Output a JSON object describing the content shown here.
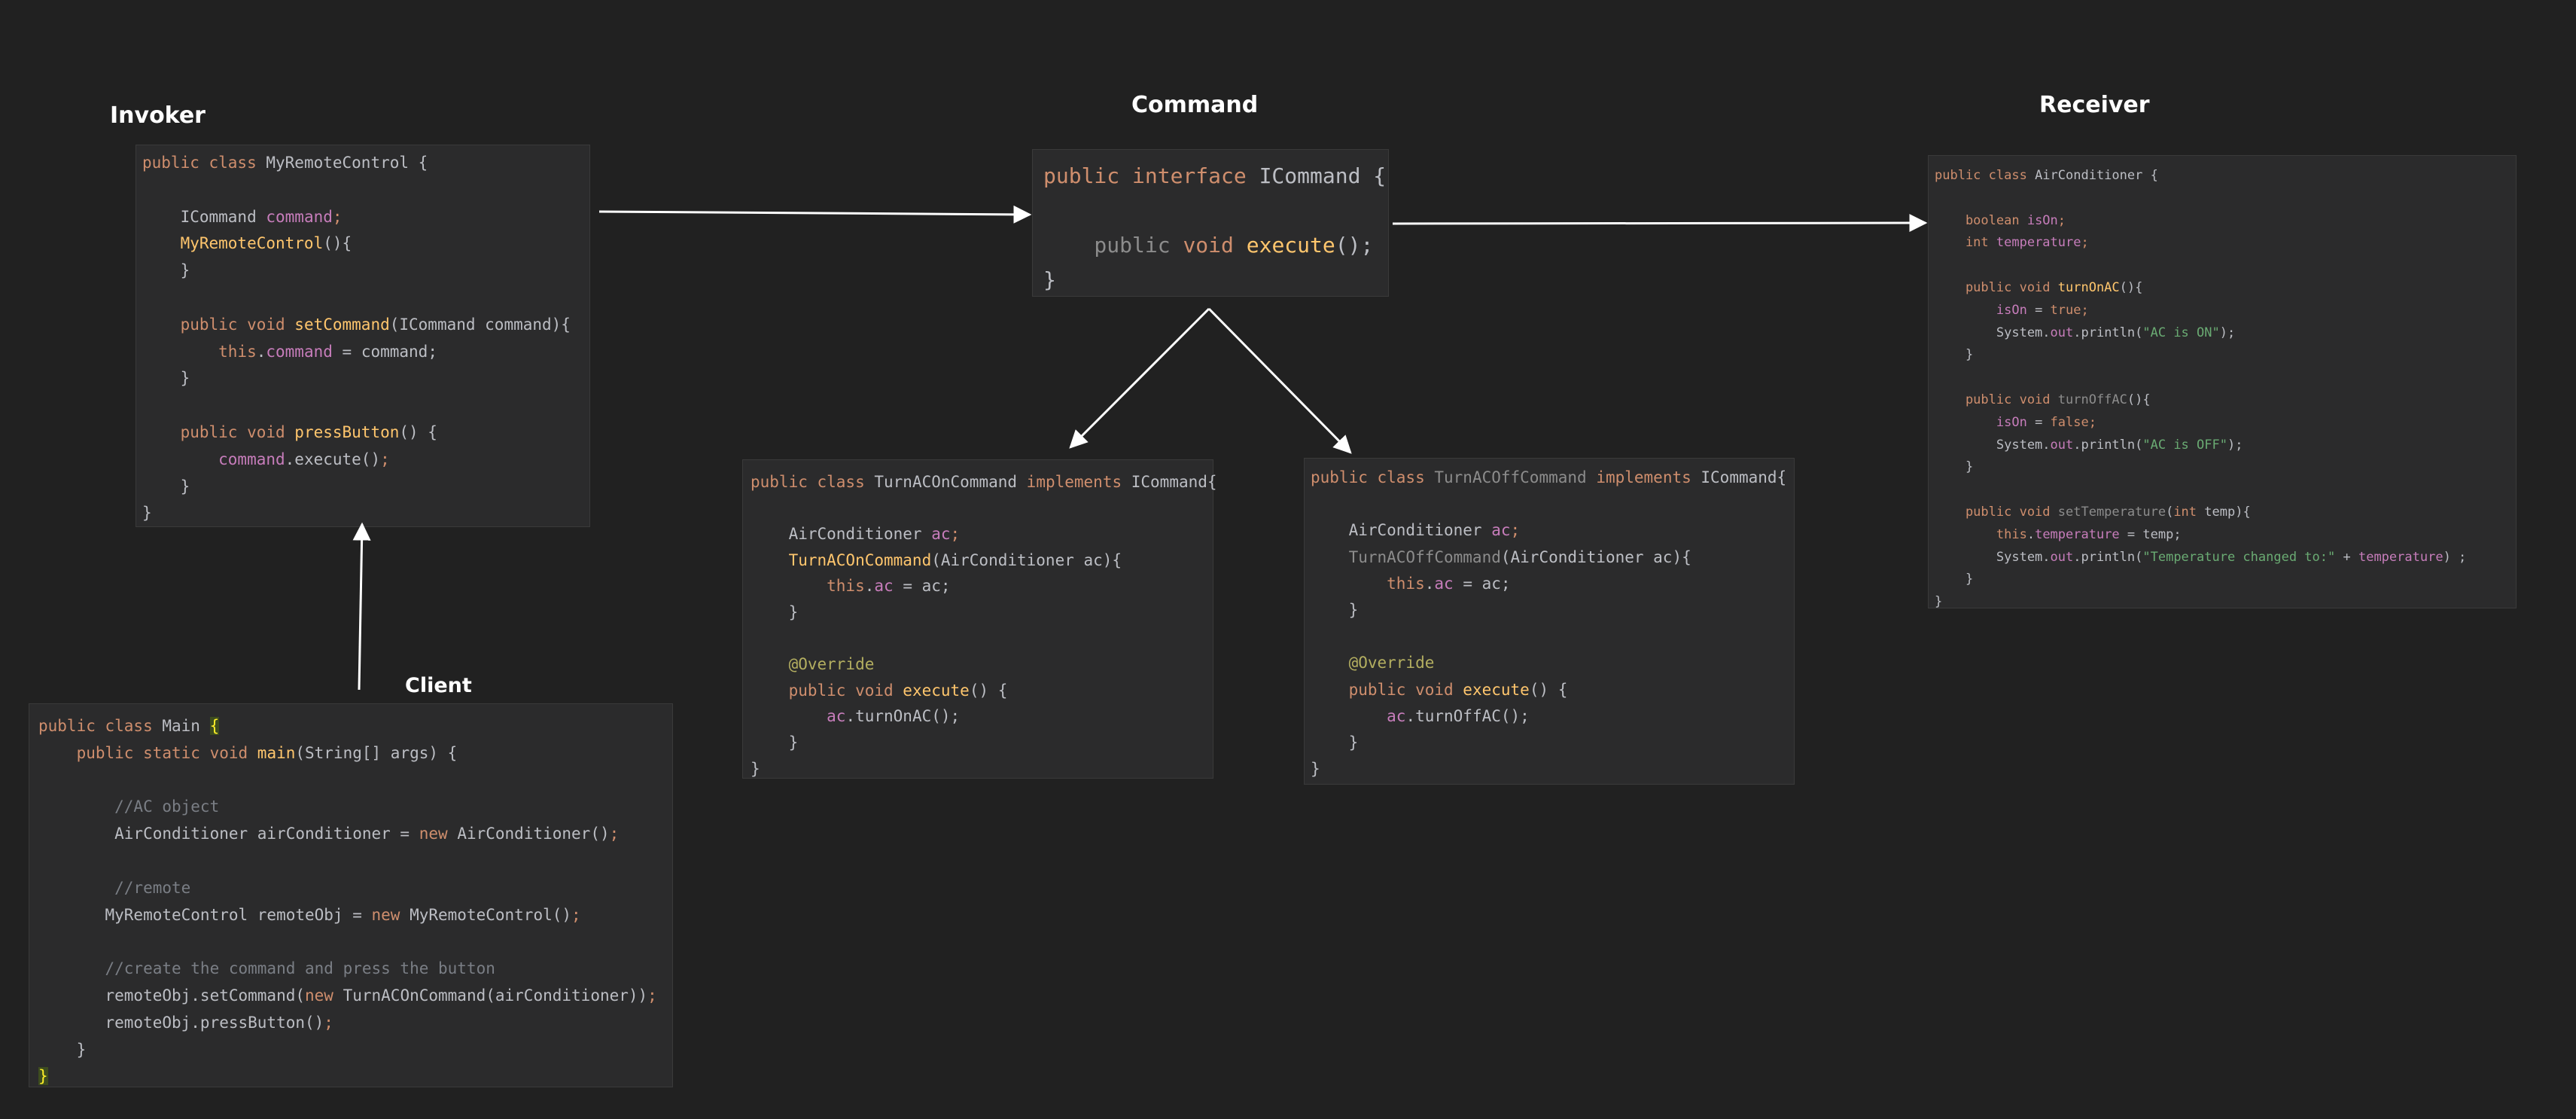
{
  "titles": {
    "invoker": "Invoker",
    "command": "Command",
    "receiver": "Receiver",
    "client": "Client"
  },
  "invoker_code": [
    [
      [
        "k",
        "public class "
      ],
      [
        "p",
        "MyRemoteControl {"
      ]
    ],
    [],
    [
      [
        "p",
        "    ICommand "
      ],
      [
        "v",
        "command"
      ],
      [
        "k",
        ";"
      ]
    ],
    [
      [
        "f",
        "    MyRemoteControl"
      ],
      [
        "p",
        "(){"
      ]
    ],
    [
      [
        "p",
        "    }"
      ]
    ],
    [],
    [
      [
        "k",
        "    public void "
      ],
      [
        "f",
        "setCommand"
      ],
      [
        "p",
        "(ICommand command){"
      ]
    ],
    [
      [
        "k",
        "        this"
      ],
      [
        "p",
        "."
      ],
      [
        "v",
        "command"
      ],
      [
        "p",
        " = command;"
      ]
    ],
    [
      [
        "p",
        "    }"
      ]
    ],
    [],
    [
      [
        "k",
        "    public void "
      ],
      [
        "f",
        "pressButton"
      ],
      [
        "p",
        "() {"
      ]
    ],
    [
      [
        "v",
        "        command"
      ],
      [
        "p",
        ".execute()"
      ],
      [
        "k",
        ";"
      ]
    ],
    [
      [
        "p",
        "    }"
      ]
    ],
    [
      [
        "p",
        "}"
      ]
    ]
  ],
  "command_code": [
    [
      [
        "k",
        "public interface "
      ],
      [
        "p",
        "ICommand {"
      ]
    ],
    [],
    [
      [
        "g",
        "    public "
      ],
      [
        "k",
        "void "
      ],
      [
        "f",
        "execute"
      ],
      [
        "p",
        "();"
      ]
    ],
    [
      [
        "p",
        "}"
      ]
    ]
  ],
  "receiver_code": [
    [
      [
        "k",
        "public class "
      ],
      [
        "p",
        "AirConditioner {"
      ]
    ],
    [],
    [
      [
        "k",
        "    boolean "
      ],
      [
        "v",
        "isOn"
      ],
      [
        "k",
        ";"
      ]
    ],
    [
      [
        "k",
        "    int "
      ],
      [
        "v",
        "temperature"
      ],
      [
        "k",
        ";"
      ]
    ],
    [],
    [
      [
        "k",
        "    public void "
      ],
      [
        "f",
        "turnOnAC"
      ],
      [
        "p",
        "(){"
      ]
    ],
    [
      [
        "v",
        "        isOn"
      ],
      [
        "p",
        " = "
      ],
      [
        "k",
        "true;"
      ]
    ],
    [
      [
        "p",
        "        System."
      ],
      [
        "v",
        "out"
      ],
      [
        "p",
        ".println("
      ],
      [
        "s",
        "\"AC is ON\""
      ],
      [
        "p",
        ");"
      ]
    ],
    [
      [
        "p",
        "    }"
      ]
    ],
    [],
    [
      [
        "k",
        "    public void "
      ],
      [
        "g",
        "turnOffAC"
      ],
      [
        "p",
        "(){"
      ]
    ],
    [
      [
        "v",
        "        isOn"
      ],
      [
        "p",
        " = "
      ],
      [
        "k",
        "false;"
      ]
    ],
    [
      [
        "p",
        "        System."
      ],
      [
        "v",
        "out"
      ],
      [
        "p",
        ".println("
      ],
      [
        "s",
        "\"AC is OFF\""
      ],
      [
        "p",
        ");"
      ]
    ],
    [
      [
        "p",
        "    }"
      ]
    ],
    [],
    [
      [
        "k",
        "    public void "
      ],
      [
        "g",
        "setTemperature"
      ],
      [
        "p",
        "("
      ],
      [
        "k",
        "int "
      ],
      [
        "p",
        "temp){"
      ]
    ],
    [
      [
        "k",
        "        this"
      ],
      [
        "p",
        "."
      ],
      [
        "v",
        "temperature"
      ],
      [
        "p",
        " = temp;"
      ]
    ],
    [
      [
        "p",
        "        System."
      ],
      [
        "v",
        "out"
      ],
      [
        "p",
        ".println("
      ],
      [
        "s",
        "\"Temperature changed to:\""
      ],
      [
        "p",
        " + "
      ],
      [
        "v",
        "temperature"
      ],
      [
        "p",
        ") ;"
      ]
    ],
    [
      [
        "p",
        "    }"
      ]
    ],
    [
      [
        "p",
        "}"
      ]
    ]
  ],
  "on_code": [
    [
      [
        "k",
        "public class "
      ],
      [
        "p",
        "TurnACOnCommand "
      ],
      [
        "k",
        "implements "
      ],
      [
        "p",
        "ICommand{"
      ]
    ],
    [],
    [
      [
        "p",
        "    AirConditioner "
      ],
      [
        "v",
        "ac"
      ],
      [
        "k",
        ";"
      ]
    ],
    [
      [
        "f",
        "    TurnACOnCommand"
      ],
      [
        "p",
        "(AirConditioner ac){"
      ]
    ],
    [
      [
        "k",
        "        this"
      ],
      [
        "p",
        "."
      ],
      [
        "v",
        "ac"
      ],
      [
        "p",
        " = ac;"
      ]
    ],
    [
      [
        "p",
        "    }"
      ]
    ],
    [],
    [
      [
        "a",
        "    @Override"
      ]
    ],
    [
      [
        "k",
        "    public void "
      ],
      [
        "f",
        "execute"
      ],
      [
        "p",
        "() {"
      ]
    ],
    [
      [
        "v",
        "        ac"
      ],
      [
        "p",
        ".turnOnAC();"
      ]
    ],
    [
      [
        "p",
        "    }"
      ]
    ],
    [
      [
        "p",
        "}"
      ]
    ]
  ],
  "off_code": [
    [
      [
        "k",
        "public class "
      ],
      [
        "g",
        "TurnACOffCommand "
      ],
      [
        "k",
        "implements "
      ],
      [
        "p",
        "ICommand{"
      ]
    ],
    [],
    [
      [
        "p",
        "    AirConditioner "
      ],
      [
        "v",
        "ac"
      ],
      [
        "k",
        ";"
      ]
    ],
    [
      [
        "g",
        "    TurnACOffCommand"
      ],
      [
        "p",
        "(AirConditioner ac){"
      ]
    ],
    [
      [
        "k",
        "        this"
      ],
      [
        "p",
        "."
      ],
      [
        "v",
        "ac"
      ],
      [
        "p",
        " = ac;"
      ]
    ],
    [
      [
        "p",
        "    }"
      ]
    ],
    [],
    [
      [
        "a",
        "    @Override"
      ]
    ],
    [
      [
        "k",
        "    public void "
      ],
      [
        "f",
        "execute"
      ],
      [
        "p",
        "() {"
      ]
    ],
    [
      [
        "v",
        "        ac"
      ],
      [
        "p",
        ".turnOffAC();"
      ]
    ],
    [
      [
        "p",
        "    }"
      ]
    ],
    [
      [
        "p",
        "}"
      ]
    ]
  ],
  "client_code": [
    [
      [
        "k",
        "public class "
      ],
      [
        "p",
        "Main "
      ],
      [
        "h",
        "{"
      ]
    ],
    [
      [
        "k",
        "    public static void "
      ],
      [
        "f",
        "main"
      ],
      [
        "p",
        "(String[] args) {"
      ]
    ],
    [],
    [
      [
        "c",
        "        //AC object"
      ]
    ],
    [
      [
        "p",
        "        AirConditioner airConditioner = "
      ],
      [
        "k",
        "new "
      ],
      [
        "p",
        "AirConditioner()"
      ],
      [
        "k",
        ";"
      ]
    ],
    [],
    [
      [
        "c",
        "        //remote"
      ]
    ],
    [
      [
        "p",
        "       MyRemoteControl remoteObj = "
      ],
      [
        "k",
        "new "
      ],
      [
        "p",
        "MyRemoteControl()"
      ],
      [
        "k",
        ";"
      ]
    ],
    [],
    [
      [
        "c",
        "       //create the command and press the button"
      ]
    ],
    [
      [
        "p",
        "       remoteObj.setCommand("
      ],
      [
        "k",
        "new "
      ],
      [
        "p",
        "TurnACOnCommand(airConditioner))"
      ],
      [
        "k",
        ";"
      ]
    ],
    [
      [
        "p",
        "       remoteObj.pressButton()"
      ],
      [
        "k",
        ";"
      ]
    ],
    [
      [
        "p",
        "    }"
      ]
    ],
    [
      [
        "h",
        "}"
      ]
    ]
  ]
}
